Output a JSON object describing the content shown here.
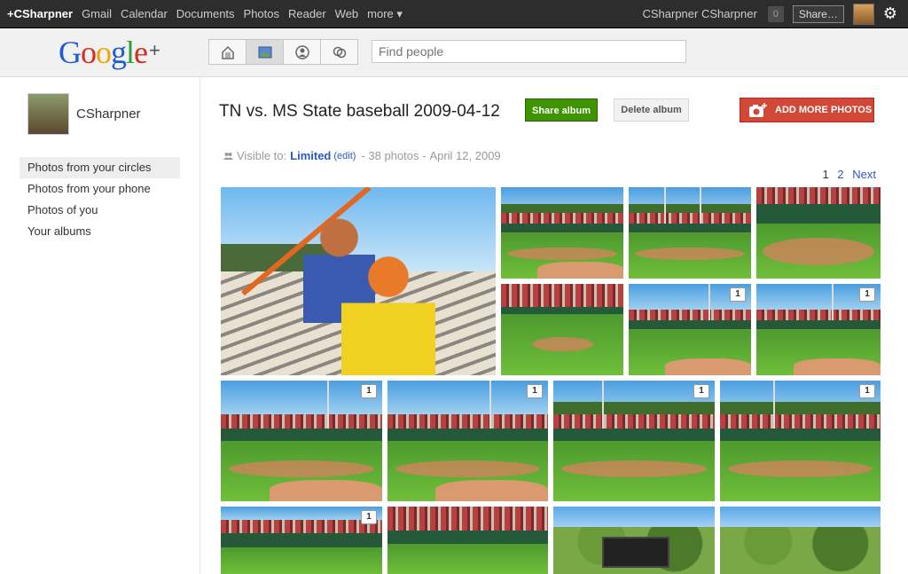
{
  "topbar": {
    "me": "+CSharpner",
    "links": [
      "Gmail",
      "Calendar",
      "Documents",
      "Photos",
      "Reader",
      "Web",
      "more ▾"
    ],
    "user": "CSharpner CSharpner",
    "notif_count": "0",
    "share_label": "Share…"
  },
  "header": {
    "logo_text": "Google",
    "logo_plus": "+",
    "search_placeholder": "Find people"
  },
  "sidebar": {
    "profile_name": "CSharpner",
    "links": [
      "Photos from your circles",
      "Photos from your phone",
      "Photos of you",
      "Your albums"
    ]
  },
  "album": {
    "title": "TN vs. MS State baseball 2009-04-12",
    "share_button": "Share album",
    "delete_button": "Delete album",
    "add_button": "ADD MORE PHOTOS",
    "visible_label": "Visible to:",
    "visibility": "Limited",
    "edit_label": "(edit)",
    "photo_count": "- 38 photos -",
    "date": "April 12, 2009"
  },
  "pager": {
    "current": "1",
    "page2": "2",
    "next": "Next"
  },
  "photos": {
    "badges": [
      "1",
      "1",
      "1",
      "1",
      "1",
      "1",
      "1"
    ]
  },
  "colors": {
    "share_green": "#3d9400",
    "add_red": "#d14836",
    "link_blue": "#2b58c8",
    "topbar": "#2d2d2d"
  }
}
